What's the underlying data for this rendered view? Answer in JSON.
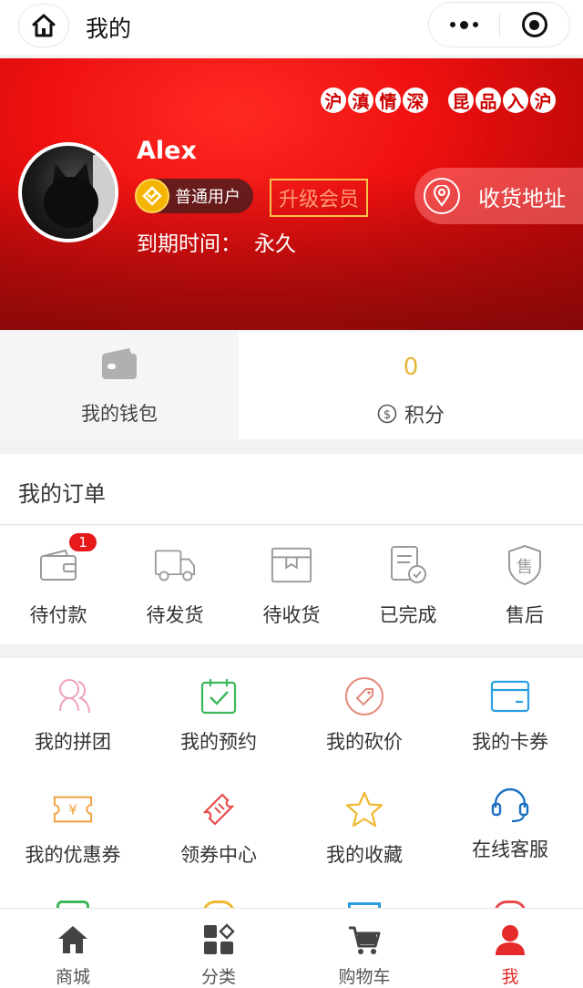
{
  "nav": {
    "title": "我的",
    "home_icon": "home-icon",
    "more_icon": "more-dots-icon",
    "close_icon": "target-icon"
  },
  "hero": {
    "slogan_1": [
      "沪",
      "滇",
      "情",
      "深"
    ],
    "slogan_2": [
      "昆",
      "品",
      "入",
      "沪"
    ],
    "username": "Alex",
    "member_level": "普通用户",
    "upgrade_label": "升级会员",
    "expire_label": "到期时间：",
    "expire_value": "永久",
    "address_label": "收货地址",
    "theme_color": "#e81212"
  },
  "wallet": {
    "label": "我的钱包"
  },
  "points": {
    "value": "0",
    "label": "积分",
    "value_color": "#e8b43a"
  },
  "orders": {
    "title": "我的订单",
    "items": [
      {
        "label": "待付款",
        "badge": "1"
      },
      {
        "label": "待发货"
      },
      {
        "label": "待收货"
      },
      {
        "label": "已完成"
      },
      {
        "label": "售后"
      }
    ]
  },
  "services": [
    {
      "label": "我的拼团",
      "icon": "group-buy-icon",
      "color": "#f0a0c0"
    },
    {
      "label": "我的预约",
      "icon": "calendar-check-icon",
      "color": "#3cb85a"
    },
    {
      "label": "我的砍价",
      "icon": "bargain-tag-icon",
      "color": "#e58a7a"
    },
    {
      "label": "我的卡券",
      "icon": "card-icon",
      "color": "#2a9ee0"
    },
    {
      "label": "我的优惠券",
      "icon": "coupon-icon",
      "color": "#f0a040"
    },
    {
      "label": "领券中心",
      "icon": "ticket-icon",
      "color": "#e84a4a"
    },
    {
      "label": "我的收藏",
      "icon": "star-icon",
      "color": "#f0b830"
    },
    {
      "label": "在线客服",
      "icon": "headset-icon",
      "color": "#1a6fc0"
    }
  ],
  "tabbar": {
    "items": [
      {
        "label": "商城"
      },
      {
        "label": "分类"
      },
      {
        "label": "购物车"
      },
      {
        "label": "我"
      }
    ],
    "active_color": "#e52a2a"
  }
}
